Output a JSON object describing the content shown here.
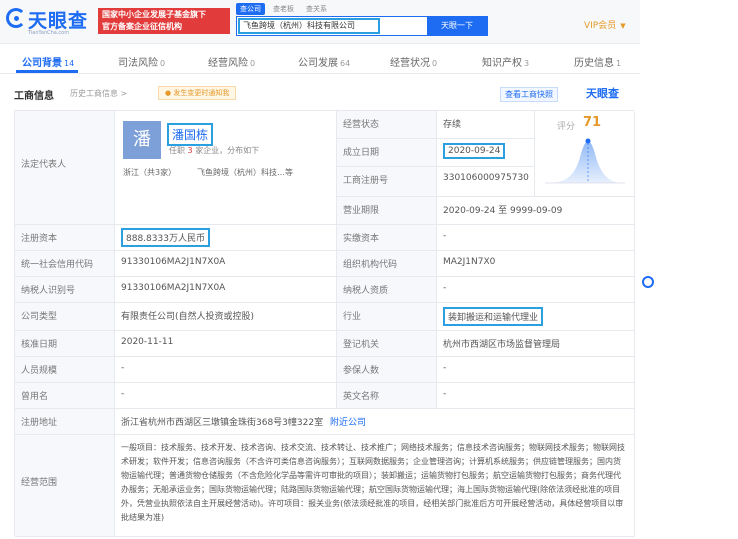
{
  "header": {
    "logo_text": "天眼查",
    "logo_url": "TianYanCha.com",
    "promo_line1": "国家中小企业发展子基金旗下",
    "promo_line2": "官方备案企业征信机构",
    "search_tabs": [
      "查公司",
      "查老板",
      "查关系"
    ],
    "search_value": "飞鱼跨境（杭州）科技有限公司",
    "search_button": "天眼一下",
    "vip_label": "VIP会员"
  },
  "tabs": [
    {
      "label": "公司背景",
      "count": "14"
    },
    {
      "label": "司法风险",
      "count": "0"
    },
    {
      "label": "经营风险",
      "count": "0"
    },
    {
      "label": "公司发展",
      "count": "64"
    },
    {
      "label": "经营状况",
      "count": "0"
    },
    {
      "label": "知识产权",
      "count": "3"
    },
    {
      "label": "历史信息",
      "count": "1"
    }
  ],
  "section": {
    "title": "工商信息",
    "history_link": "历史工商信息 >",
    "change_tag": "● 发生变更时通知我",
    "report_btn": "查看工商快照",
    "brand": "天眼查"
  },
  "rep": {
    "label": "法定代表人",
    "avatar_char": "潘",
    "name": "潘国栋",
    "sub_prefix": "任职",
    "sub_count": "3",
    "sub_suffix": "家企业，分布如下",
    "region": "浙江（共3家）",
    "company": "飞鱼跨境（杭州）科技…等"
  },
  "fields": {
    "status_label": "经营状态",
    "status_value": "存续",
    "score_label": "评分",
    "score_value": "71",
    "estab_label": "成立日期",
    "estab_value": "2020-09-24",
    "regno_label": "工商注册号",
    "regno_value": "330106000975730",
    "period_label": "营业期限",
    "period_value": "2020-09-24 至 9999-09-09",
    "capital_label": "注册资本",
    "capital_value": "888.8333万人民币",
    "paid_label": "实缴资本",
    "paid_value": "-",
    "credit_label": "统一社会信用代码",
    "credit_value": "91330106MA2J1N7X0A",
    "org_label": "组织机构代码",
    "org_value": "MA2J1N7X0",
    "tax_label": "纳税人识别号",
    "tax_value": "91330106MA2J1N7X0A",
    "taxq_label": "纳税人资质",
    "taxq_value": "-",
    "type_label": "公司类型",
    "type_value": "有限责任公司(自然人投资或控股)",
    "industry_label": "行业",
    "industry_value": "装卸搬运和运输代理业",
    "approve_label": "核准日期",
    "approve_value": "2020-11-11",
    "authority_label": "登记机关",
    "authority_value": "杭州市西湖区市场监督管理局",
    "staff_label": "人员规模",
    "staff_value": "-",
    "insured_label": "参保人数",
    "insured_value": "-",
    "former_label": "曾用名",
    "former_value": "-",
    "english_label": "英文名称",
    "english_value": "-",
    "address_label": "注册地址",
    "address_value": "浙江省杭州市西湖区三墩镇金珠街368号3幢322室",
    "address_link": "附近公司",
    "scope_label": "经营范围",
    "scope_value": "一般项目：技术服务、技术开发、技术咨询、技术交流、技术转让、技术推广；网络技术服务；信息技术咨询服务；物联网技术服务；物联网技术研发；软件开发；信息咨询服务（不含许可类信息咨询服务）；互联网数据服务；企业管理咨询；计算机系统服务；供应链管理服务；国内货物运输代理；普通货物仓储服务（不含危险化学品等需许可审批的项目）；装卸搬运；运输货物打包服务；航空运输货物打包服务；商务代理代办服务；无船承运业务；国际货物运输代理；陆路国际货物运输代理；航空国际货物运输代理；海上国际货物运输代理(除依法须经批准的项目外，凭营业执照依法自主开展经营活动)。许可项目：报关业务(依法须经批准的项目，经相关部门批准后方可开展经营活动，具体经营项目以审批结果为准)"
  }
}
